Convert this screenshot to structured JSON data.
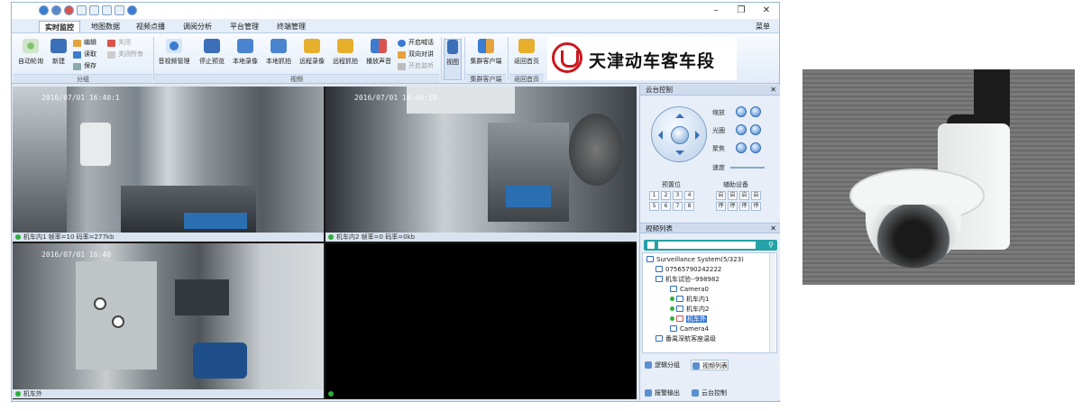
{
  "window": {
    "menu_tabs": [
      "实时监控",
      "地图数据",
      "视频点播",
      "调阅分析",
      "平台管理",
      "终端管理"
    ],
    "menu_right": "菜单",
    "window_controls": [
      "–",
      "❐",
      "✕"
    ]
  },
  "ribbon": {
    "groups": [
      {
        "label": "分组"
      },
      {
        "label": "视频"
      },
      {
        "label": "集群客户端"
      },
      {
        "label": "返回首页"
      }
    ],
    "buttons": {
      "auto_poll": "自动轮询",
      "new": "新建",
      "edit": "编辑",
      "read": "读取",
      "save": "保存",
      "close": "关闭",
      "close_all": "关闭所有",
      "video_manage": "音视频管理",
      "stop_preview": "停止预览",
      "local_record": "本地录像",
      "local_capture": "本地抓拍",
      "remote_record": "远程录像",
      "remote_capture": "远程抓拍",
      "play_sound": "播放声音",
      "open_call": "开启喊话",
      "two_way": "双向对讲",
      "open_listen": "开启监听",
      "view": "视图",
      "cluster_client": "集群客户端",
      "return_home": "返回首页"
    }
  },
  "brand": {
    "name": "天津动车客车段",
    "color": "#c8181e"
  },
  "video_panes": [
    {
      "timestamp": "2016/07/01 16:40:1",
      "caption": "机车内1  帧率=10  码率=277kb"
    },
    {
      "timestamp": "2016/07/01 16:40:19",
      "caption": "机车内2  帧率=0  码率=0kb"
    },
    {
      "timestamp": "2016/07/01 16:40",
      "caption": "机车外"
    },
    {
      "timestamp": "",
      "caption": ""
    }
  ],
  "ptz": {
    "title": "云台控制",
    "zoom": "缩放",
    "iris": "光圈",
    "focus": "聚焦",
    "speed": "速度",
    "preset": "预置位",
    "aux": "辅助设备",
    "preset_keys": [
      "1",
      "2",
      "3",
      "4",
      "5",
      "6",
      "7",
      "8"
    ],
    "aux_keys": [
      "启",
      "启",
      "启",
      "启",
      "停",
      "停",
      "停",
      "停"
    ]
  },
  "video_list": {
    "title": "视频列表",
    "search_placeholder": "",
    "tree": [
      {
        "label": "Surveillance System(5/323)",
        "indent": 0
      },
      {
        "label": "07565790242222",
        "indent": 1
      },
      {
        "label": "机车试验--998982",
        "indent": 1
      },
      {
        "label": "Camera0",
        "indent": 2
      },
      {
        "label": "机车内1",
        "indent": 2
      },
      {
        "label": "机车内2",
        "indent": 2
      },
      {
        "label": "机车外",
        "indent": 2
      },
      {
        "label": "Camera4",
        "indent": 2
      },
      {
        "label": "番禺深航客座温级",
        "indent": 1
      }
    ],
    "tabs": [
      "逻辑分组",
      "视频列表"
    ],
    "bottom_tabs": [
      "报警输出",
      "云台控制"
    ]
  }
}
